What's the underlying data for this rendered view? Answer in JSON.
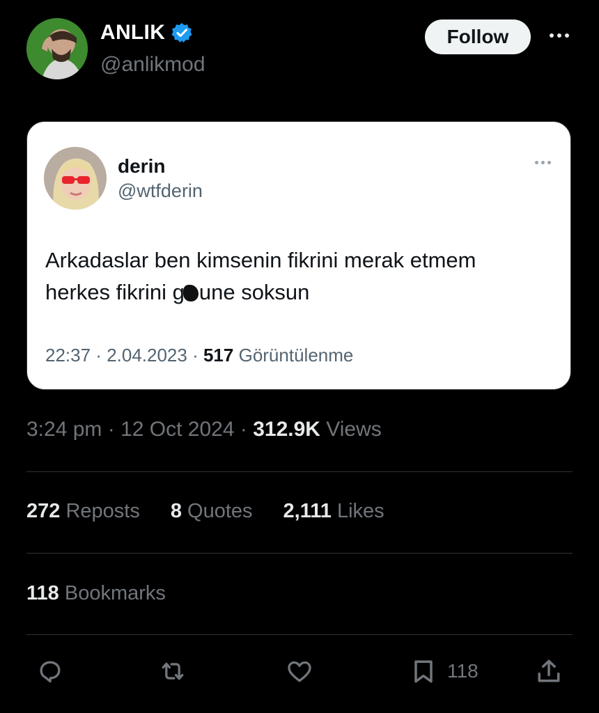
{
  "author": {
    "display_name": "ANLIK",
    "handle": "@anlikmod",
    "follow_label": "Follow",
    "avatar": "avatar-photo"
  },
  "quoted": {
    "display_name": "derin",
    "handle": "@wtfderin",
    "text_line1": "Arkadaslar ben kimsenin fikrini merak etmem",
    "text_line2_before": "herkes fikrini g",
    "text_line2_after": "une soksun",
    "time": "22:37",
    "date": "2.04.2023",
    "views_count": "517",
    "views_label": "Görüntülenme"
  },
  "post": {
    "time": "3:24 pm",
    "date": "12 Oct 2024",
    "views_count": "312.9K",
    "views_label": "Views",
    "reposts_count": "272",
    "reposts_label": "Reposts",
    "quotes_count": "8",
    "quotes_label": "Quotes",
    "likes_count": "2,111",
    "likes_label": "Likes",
    "bookmarks_count": "118",
    "bookmarks_label": "Bookmarks",
    "bookmark_action_count": "118"
  },
  "icons": {
    "verified": "verified-badge-icon",
    "reply": "reply-icon",
    "repost": "repost-icon",
    "like": "heart-icon",
    "bookmark": "bookmark-icon",
    "share": "share-icon",
    "more": "more-icon"
  },
  "colors": {
    "background": "#000000",
    "verified": "#1d9bf0",
    "follow_bg": "#eff3f4",
    "muted": "#71767b"
  }
}
